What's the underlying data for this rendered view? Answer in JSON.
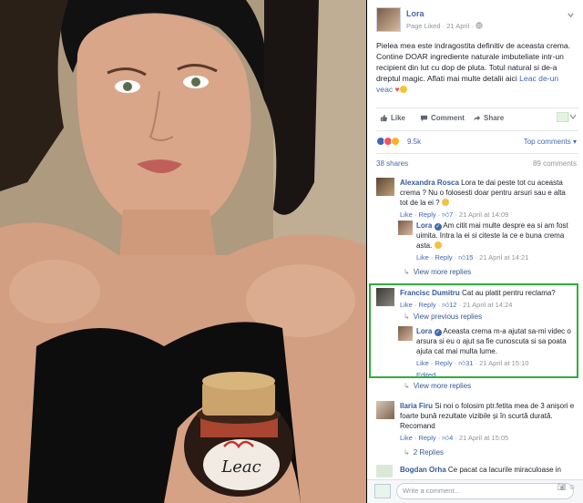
{
  "post": {
    "page_name": "Lora",
    "meta": "Page Liked · 21 April ·",
    "text": "Pielea mea este indragostita definitiv de aceasta crema. Contine DOAR ingrediente naturale imbuteliate intr-un recipient din lut cu dop de pluta. Totul natural si de-a dreptul magic. Aflati mai multe detalii aici",
    "link_text": "Leac de-un veac",
    "actions": {
      "like": "Like",
      "comment": "Comment",
      "share": "Share"
    },
    "reaction_count": "9.5k",
    "top_comments": "Top comments ▾",
    "shares": "38 shares",
    "comments_count": "89 comments"
  },
  "comments": [
    {
      "author": "Alexandra Rosca",
      "text": "Lora te dai peste tot cu aceasta crema ? Nu o folosesti doar pentru arsuri sau e alta tot de la ei ?",
      "like": "Like",
      "reply": "Reply",
      "likes": "7",
      "time": "21 April at 14:09"
    },
    {
      "author": "Lora",
      "text": "Am citit mai multe despre ea si am fost uimita. Intra la ei si citeste la ce e buna crema asta.",
      "like": "Like",
      "reply": "Reply",
      "likes": "15",
      "time": "21 April at 14:21"
    },
    {
      "author": "Francisc Dumitru",
      "text": "Cat au platit pentru reclama?",
      "like": "Like",
      "reply": "Reply",
      "likes": "12",
      "time": "21 April at 14:24"
    },
    {
      "author": "Lora",
      "text": "Aceasta crema m-a ajutat sa-mi videc o arsura si eu o ajut sa fie cunoscuta si sa poata ajuta cat mai multa lume.",
      "like": "Like",
      "reply": "Reply",
      "likes": "31",
      "time": "21 April at 15:10",
      "edited": "Edited"
    },
    {
      "author": "Ilaria Firu",
      "text": "Si noi o folosim ptr.fetita mea de 3 anișori e foarte bună rezultate vizibile și în scurtă durată. Recomand",
      "like": "Like",
      "reply": "Reply",
      "likes": "4",
      "time": "21 April at 15:05"
    },
    {
      "author": "Bogdan Orha",
      "text": "Ce pacat ca lacurile miraculoase in"
    }
  ],
  "view_more_replies": "View more replies",
  "view_previous_replies": "View previous replies",
  "two_replies": "2 Replies",
  "write_placeholder": "Write a comment...",
  "jar_brand": "Leac",
  "icons": {
    "like": "thumbs-up-icon",
    "comment": "comment-icon",
    "share": "share-icon",
    "reply": "reply-arrow-icon",
    "camera": "camera-icon",
    "emoji": "emoji-icon"
  },
  "colors": {
    "facebook_blue": "#4267b2",
    "highlight_green": "#2eaf3c"
  }
}
